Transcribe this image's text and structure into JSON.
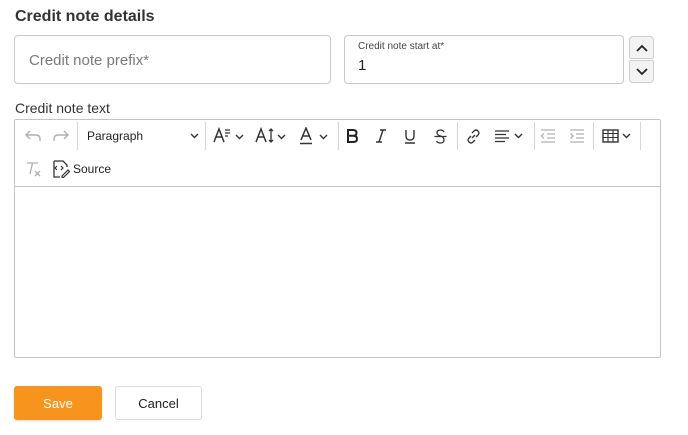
{
  "section": {
    "title": "Credit note details"
  },
  "prefix_field": {
    "placeholder": "Credit note prefix*"
  },
  "start_field": {
    "label": "Credit note start at*",
    "value": "1"
  },
  "editor": {
    "label": "Credit note text",
    "paragraph_style": "Paragraph",
    "source_label": "Source",
    "toolbar_icons": [
      "undo-icon",
      "redo-icon",
      "paragraph-dropdown",
      "font-size-icon",
      "font-family-icon",
      "font-color-icon",
      "bold-icon",
      "italic-icon",
      "underline-icon",
      "strikethrough-icon",
      "link-icon",
      "align-icon",
      "outdent-icon",
      "indent-icon",
      "table-icon",
      "remove-format-icon",
      "source-icon"
    ]
  },
  "actions": {
    "save_label": "Save",
    "cancel_label": "Cancel"
  },
  "colors": {
    "accent": "#f7941d",
    "border": "#c9c9c9"
  }
}
